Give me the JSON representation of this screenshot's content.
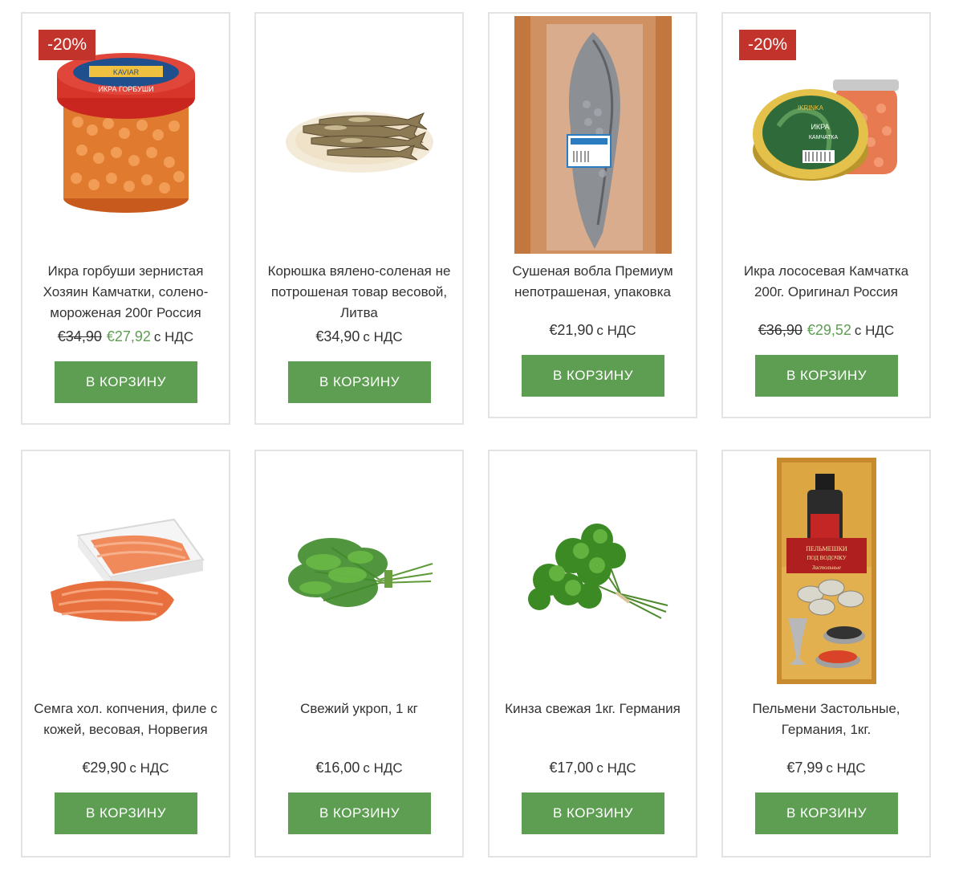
{
  "currency_note": "с НДС",
  "cart_label": "В КОРЗИНУ",
  "colors": {
    "accent_green": "#5e9e52",
    "badge_red": "#c2332b",
    "card_border": "#e3e3e3"
  },
  "products": [
    {
      "title": "Икра горбуши зернистая Хозяин Камчатки, солено-мороженая 200г Россия",
      "badge": "-20%",
      "old_price": "€34,90",
      "price": "€27,92",
      "vat": "с НДС",
      "button": "В КОРЗИНУ",
      "image_icon": "caviar-jar-icon",
      "image_text": [
        "Хозяин Камчатки",
        "KAVIAR",
        "ИКРА ГОРБУШИ",
        "200г"
      ]
    },
    {
      "title": "Корюшка вялено-соленая не потрошеная товар весовой, Литва",
      "badge": "",
      "old_price": "",
      "price": "€34,90",
      "vat": "с НДС",
      "button": "В КОРЗИНУ",
      "image_icon": "dried-smelt-plate-icon"
    },
    {
      "title": "Сушеная вобла Премиум непотрашеная, упаковка",
      "badge": "",
      "old_price": "",
      "price": "€21,90",
      "vat": "с НДС",
      "button": "В КОРЗИНУ",
      "image_icon": "dried-roach-fish-icon"
    },
    {
      "title": "Икра лососевая Камчатка 200г. Оригинал Россия",
      "badge": "-20%",
      "old_price": "€36,90",
      "price": "€29,52",
      "vat": "с НДС",
      "button": "В КОРЗИНУ",
      "image_icon": "salmon-caviar-tin-icon",
      "image_text": [
        "IKRINKA",
        "ИКРА",
        "КАМЧАТКА",
        "Original",
        "200г"
      ]
    },
    {
      "title": "Семга хол. копчения, филе с кожей, весовая, Норвегия",
      "badge": "",
      "old_price": "",
      "price": "€29,90",
      "vat": "с НДС",
      "button": "В КОРЗИНУ",
      "image_icon": "smoked-salmon-fillet-icon"
    },
    {
      "title": "Свежий укроп, 1 кг",
      "badge": "",
      "old_price": "",
      "price": "€16,00",
      "vat": "с НДС",
      "button": "В КОРЗИНУ",
      "image_icon": "dill-bunch-icon"
    },
    {
      "title": "Кинза свежая 1кг. Германия",
      "badge": "",
      "old_price": "",
      "price": "€17,00",
      "vat": "с НДС",
      "button": "В КОРЗИНУ",
      "image_icon": "cilantro-bunch-icon"
    },
    {
      "title": "Пельмени Застольные, Германия, 1кг.",
      "badge": "",
      "old_price": "",
      "price": "€7,99",
      "vat": "с НДС",
      "button": "В КОРЗИНУ",
      "image_icon": "dumplings-package-icon",
      "image_text": [
        "ПЕЛЬМЕШКИ",
        "ПОД ВОДОЧКУ",
        "Застольные"
      ]
    }
  ]
}
